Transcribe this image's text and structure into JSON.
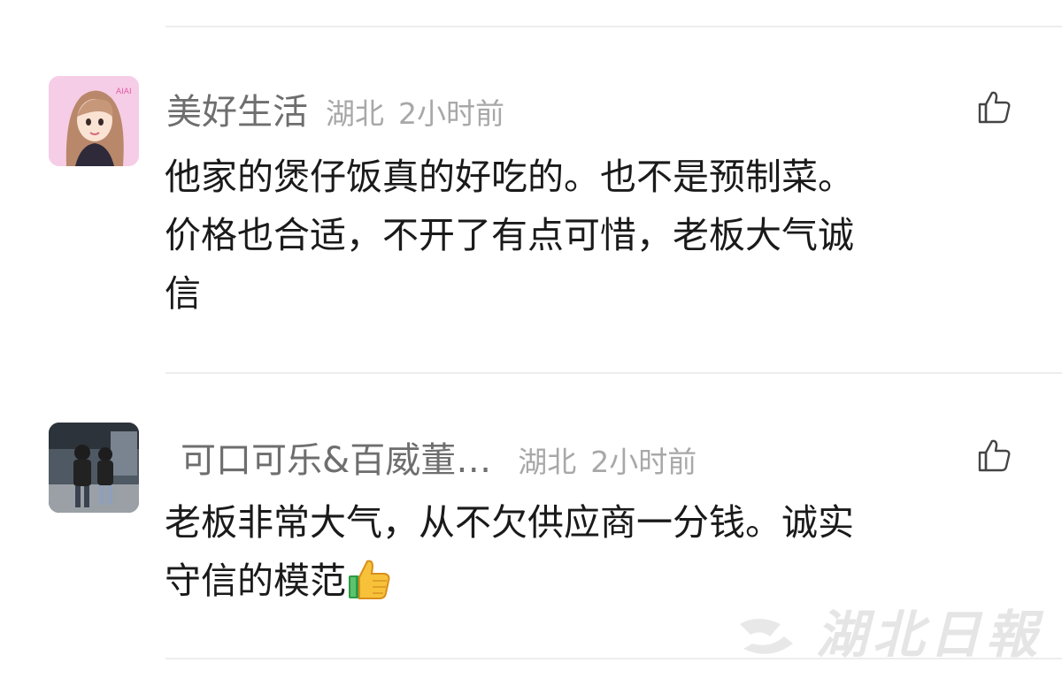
{
  "comments": [
    {
      "username": "美好生活",
      "location": "湖北",
      "time": "2小时前",
      "text_lines": [
        "他家的煲仔饭真的好吃的。也不是预制菜。",
        "价格也合适，不开了有点可惜，老板大气诚",
        "信"
      ],
      "avatar": "cartoon-girl-avatar",
      "like_icon": "thumbs-up-outline-icon"
    },
    {
      "username": "可口可乐&百威董…",
      "location": "湖北",
      "time": "2小时前",
      "text_lines": [
        "老板非常大气，从不欠供应商一分钱。诚实",
        "守信的模范"
      ],
      "emoji": "thumbs-up-emoji",
      "avatar": "two-children-photo-avatar",
      "like_icon": "thumbs-up-outline-icon"
    }
  ],
  "watermark": {
    "text": "湖北日報"
  },
  "colors": {
    "background": "#ffffff",
    "username": "#6e6e6e",
    "meta": "#a8a8a8",
    "text": "#1a1a1a",
    "divider": "#ededed"
  }
}
